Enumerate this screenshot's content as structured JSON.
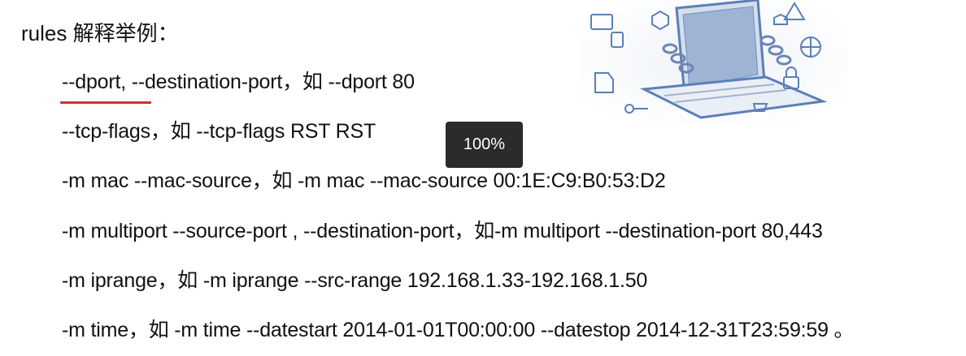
{
  "heading": "rules 解释举例：",
  "lines": [
    "--dport, --destination-port，如 --dport 80",
    "--tcp-flags，如 --tcp-flags RST RST",
    "-m mac --mac-source，如 -m mac --mac-source 00:1E:C9:B0:53:D2",
    "-m multiport --source-port , --destination-port，如-m multiport --destination-port 80,443",
    "-m iprange，如 -m iprange --src-range 192.168.1.33-192.168.1.50",
    "-m time，如 -m time --datestart 2014-01-01T00:00:00 --datestop 2014-12-31T23:59:59 。"
  ],
  "tooltip": {
    "zoom_label": "100%"
  },
  "colors": {
    "underline": "#d0312d",
    "illustration_blue": "#5b7fb8",
    "tooltip_bg": "#2b2b2b"
  }
}
